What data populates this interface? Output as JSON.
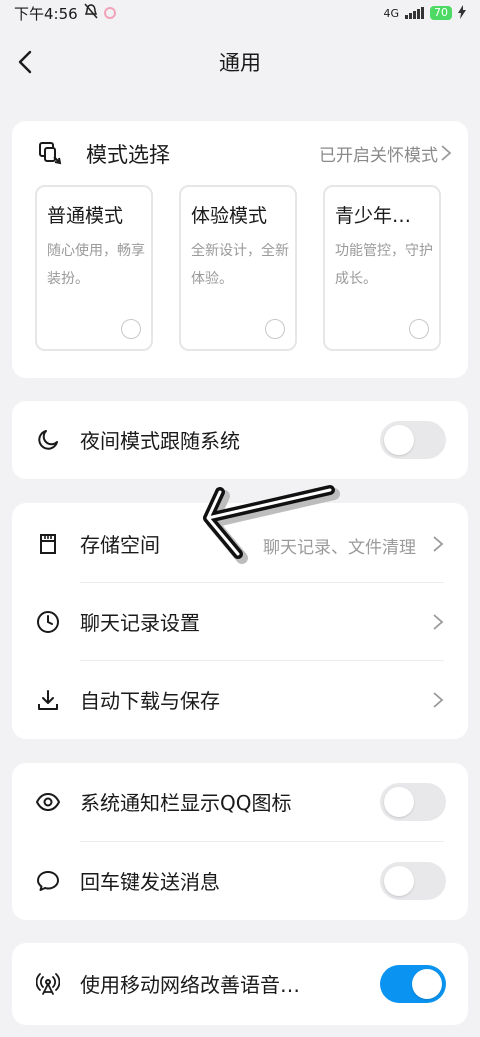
{
  "status": {
    "time": "下午4:56",
    "network": "4G",
    "battery": "70"
  },
  "nav": {
    "title": "通用"
  },
  "mode": {
    "title": "模式选择",
    "status": "已开启关怀模式",
    "options": [
      {
        "title": "普通模式",
        "desc": "随心使用，畅享装扮。"
      },
      {
        "title": "体验模式",
        "desc": "全新设计，全新体验。"
      },
      {
        "title": "青少年…",
        "desc": "功能管控，守护成长。"
      }
    ]
  },
  "night": {
    "label": "夜间模式跟随系统",
    "on": false
  },
  "storage": {
    "rows": [
      {
        "label": "存储空间",
        "value": "聊天记录、文件清理"
      },
      {
        "label": "聊天记录设置",
        "value": ""
      },
      {
        "label": "自动下载与保存",
        "value": ""
      }
    ]
  },
  "notify": {
    "rows": [
      {
        "label": "系统通知栏显示QQ图标",
        "on": false
      },
      {
        "label": "回车键发送消息",
        "on": false
      }
    ]
  },
  "network": {
    "label": "使用移动网络改善语音…",
    "on": true
  },
  "colors": {
    "accent": "#0a93f0",
    "background": "#f2f2f4"
  }
}
